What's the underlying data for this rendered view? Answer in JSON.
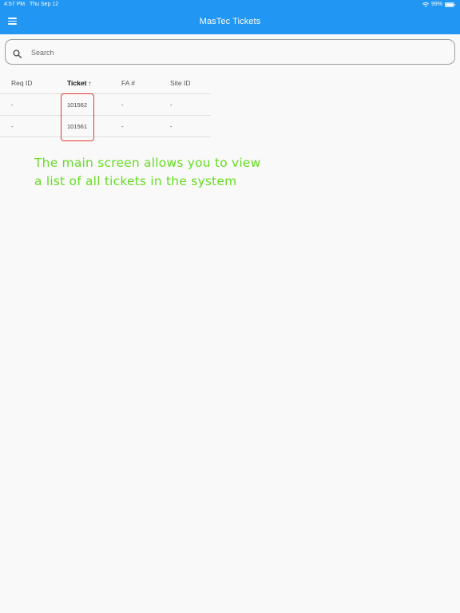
{
  "status_bar": {
    "time": "4:57 PM",
    "date": "Thu Sep 12",
    "battery": "99%"
  },
  "app_bar": {
    "title": "MasTec Tickets",
    "menu_icon": "hamburger-menu-icon",
    "background_color": "#2196f3"
  },
  "search": {
    "placeholder": "Search",
    "value": "",
    "icon": "search-icon"
  },
  "table": {
    "columns": [
      "Req ID",
      "Ticket",
      "FA #",
      "Site ID"
    ],
    "sorted_column": "Ticket",
    "sort_direction": "ascending",
    "sort_icon": "↑",
    "rows": [
      {
        "req_id": "-",
        "ticket": "101562",
        "fa": "-",
        "site_id": "-"
      },
      {
        "req_id": "-",
        "ticket": "101561",
        "fa": "-",
        "site_id": "-"
      }
    ]
  },
  "annotation": {
    "line1": "The main screen allows you to view",
    "line2": "a list of all tickets in the system",
    "color": "#66dd22",
    "highlight_color": "#e53935"
  }
}
